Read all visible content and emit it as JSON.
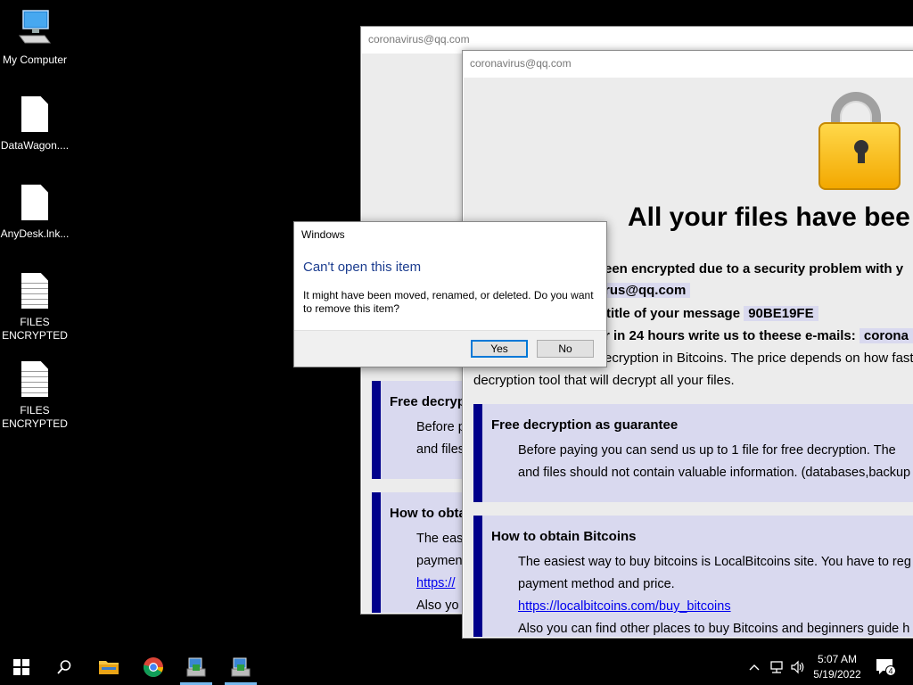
{
  "desktop": {
    "icons": [
      {
        "label": "My Computer"
      },
      {
        "label": "DataWagon...."
      },
      {
        "label": "AnyDesk.lnk..."
      },
      {
        "label": "FILES ENCRYPTED"
      },
      {
        "label": "FILES ENCRYPTED"
      }
    ]
  },
  "back_window": {
    "title": "coronavirus@qq.com",
    "panel1_heading": "Free decryp",
    "panel1_lines": [
      "Before p",
      "and files"
    ],
    "panel2_heading": "How to obta",
    "panel2_lines": [
      "The eas",
      "paymen",
      "https://",
      "Also yo"
    ]
  },
  "ransom": {
    "title": "coronavirus@qq.com",
    "headline": "All your files have bee",
    "line1": "een encrypted due to a security problem with y",
    "email_fragment": "rus@qq.com",
    "line3_text": "title of your message",
    "id_code": "90BE19FE",
    "line4_text": "r in 24 hours write us to theese e-mails:",
    "line4_email": "corona",
    "line5": "ecryption in Bitcoins. The price depends on how fast y",
    "line6": "decryption tool that will decrypt all your files.",
    "free": {
      "heading": "Free decryption as guarantee",
      "lines": [
        "Before paying you can send us up to 1 file for free decryption. The",
        "and files should not contain valuable information. (databases,backup"
      ]
    },
    "bitcoins": {
      "heading": "How to obtain Bitcoins",
      "line1": "The easiest way to buy bitcoins is LocalBitcoins site. You have to reg",
      "line2": "payment method and price.",
      "link": "https://localbitcoins.com/buy_bitcoins",
      "line4": "Also you can find other places to buy Bitcoins and beginners guide h"
    }
  },
  "dialog": {
    "title": "Windows",
    "heading": "Can't open this item",
    "message": "It might have been moved, renamed, or deleted. Do you want to remove this item?",
    "yes_label": "Yes",
    "no_label": "No"
  },
  "taskbar": {
    "time": "5:07 AM",
    "date": "5/19/2022",
    "notification_count": "4"
  }
}
